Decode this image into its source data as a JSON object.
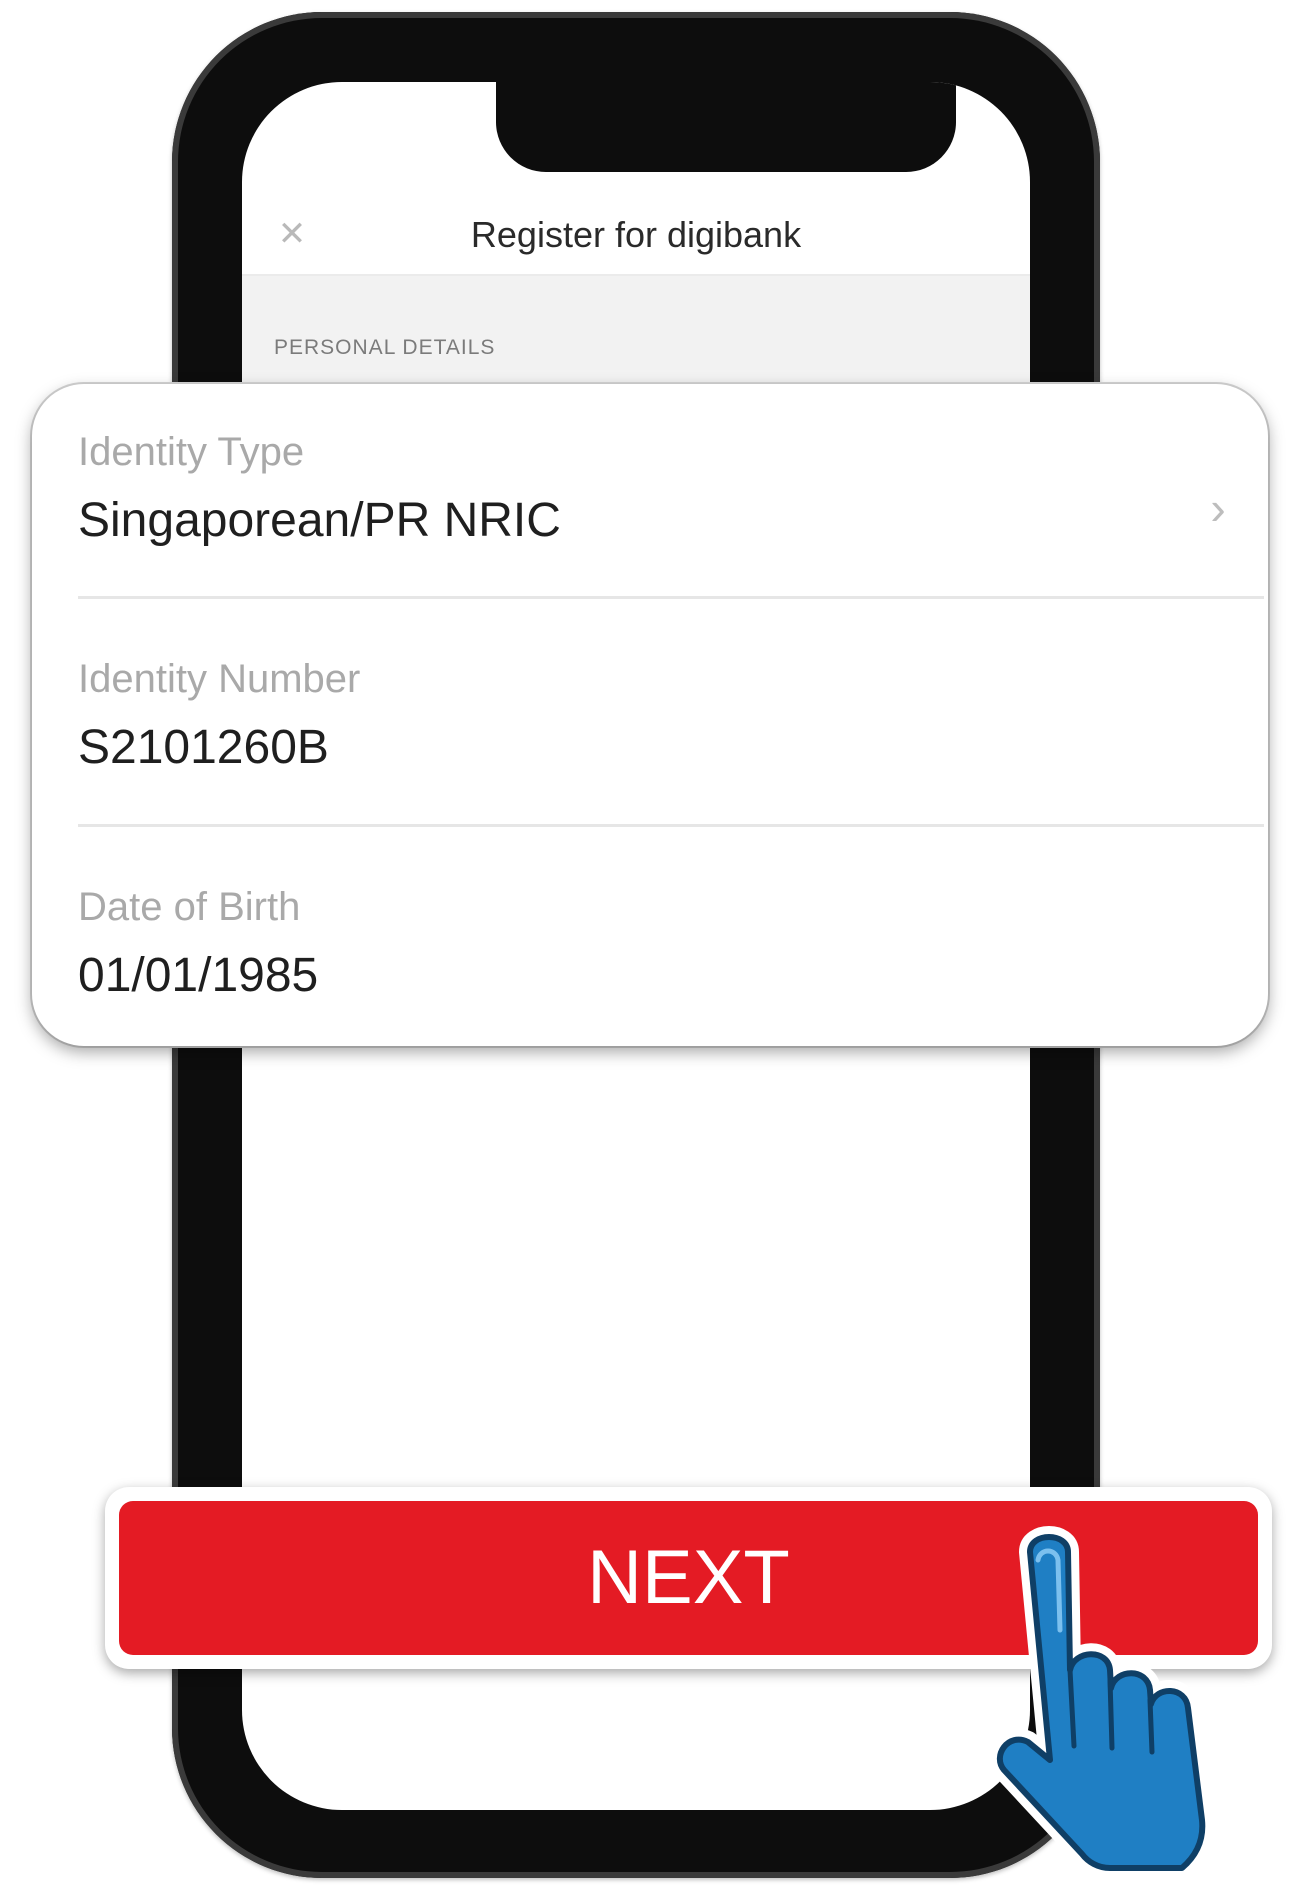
{
  "app": {
    "title": "Register for digibank",
    "close_icon": "close-icon"
  },
  "section": {
    "label": "PERSONAL DETAILS"
  },
  "form": {
    "fields": [
      {
        "label": "Identity Type",
        "value": "Singaporean/PR NRIC",
        "has_chevron": true
      },
      {
        "label": "Identity Number",
        "value": "S2101260B"
      },
      {
        "label": "Date of Birth",
        "value": "01/01/1985"
      }
    ]
  },
  "next_button": {
    "label": "NEXT",
    "color": "#e41b24"
  },
  "pointer": {
    "icon": "hand-pointer-icon",
    "color": "#1f7fc4"
  }
}
